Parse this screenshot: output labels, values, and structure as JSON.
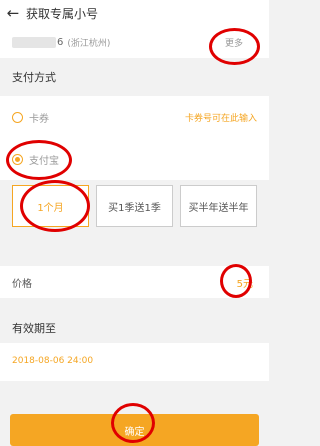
{
  "header": {
    "title": "获取专属小号"
  },
  "number": {
    "trailing_digit": "6",
    "region": "(浙江杭州)",
    "more_label": "更多"
  },
  "payment": {
    "title": "支付方式",
    "options": [
      {
        "label": "卡券",
        "checked": false
      },
      {
        "label": "支付宝",
        "checked": true
      }
    ],
    "hint": "卡券号可在此输入"
  },
  "durations": [
    {
      "label": "1个月",
      "selected": true
    },
    {
      "label": "买1季送1季",
      "selected": false
    },
    {
      "label": "买半年送半年",
      "selected": false
    }
  ],
  "price": {
    "label": "价格",
    "value": "5元"
  },
  "validity": {
    "title": "有效期至",
    "date": "2018-08-06 24:00"
  },
  "confirm_label": "确定",
  "colors": {
    "accent": "#f5a623",
    "annotation": "#e00000"
  }
}
